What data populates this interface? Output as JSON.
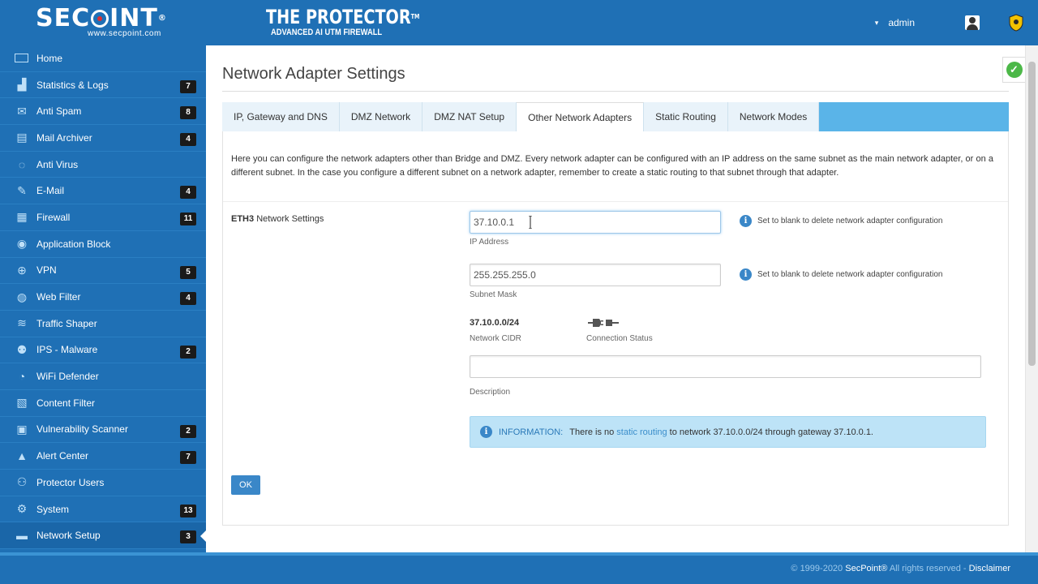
{
  "header": {
    "logo_text_1": "SEC",
    "logo_text_2": "INT",
    "logo_reg": "®",
    "logo_url": "www.secpoint.com",
    "product_title": "THE PROTECTOR",
    "product_tm": "TM",
    "product_subtitle": "ADVANCED AI UTM FIREWALL",
    "user_caret": "▾",
    "user_name": "admin"
  },
  "sidebar": {
    "items": [
      {
        "label": "Home",
        "badge": "",
        "icon": "home-icon"
      },
      {
        "label": "Statistics & Logs",
        "badge": "7",
        "icon": "chart-icon"
      },
      {
        "label": "Anti Spam",
        "badge": "8",
        "icon": "antispam-icon"
      },
      {
        "label": "Mail Archiver",
        "badge": "4",
        "icon": "archive-icon"
      },
      {
        "label": "Anti Virus",
        "badge": "",
        "icon": "antivirus-icon"
      },
      {
        "label": "E-Mail",
        "badge": "4",
        "icon": "email-icon"
      },
      {
        "label": "Firewall",
        "badge": "11",
        "icon": "firewall-icon"
      },
      {
        "label": "Application Block",
        "badge": "",
        "icon": "app-block-icon"
      },
      {
        "label": "VPN",
        "badge": "5",
        "icon": "vpn-icon"
      },
      {
        "label": "Web Filter",
        "badge": "4",
        "icon": "web-filter-icon"
      },
      {
        "label": "Traffic Shaper",
        "badge": "",
        "icon": "traffic-icon"
      },
      {
        "label": "IPS - Malware",
        "badge": "2",
        "icon": "ips-icon"
      },
      {
        "label": "WiFi Defender",
        "badge": "",
        "icon": "wifi-icon"
      },
      {
        "label": "Content Filter",
        "badge": "",
        "icon": "content-filter-icon"
      },
      {
        "label": "Vulnerability Scanner",
        "badge": "2",
        "icon": "scanner-icon"
      },
      {
        "label": "Alert Center",
        "badge": "7",
        "icon": "alert-icon"
      },
      {
        "label": "Protector Users",
        "badge": "",
        "icon": "users-icon"
      },
      {
        "label": "System",
        "badge": "13",
        "icon": "gear-icon"
      },
      {
        "label": "Network Setup",
        "badge": "3",
        "icon": "network-icon",
        "active": true
      }
    ]
  },
  "main": {
    "title": "Network Adapter Settings",
    "tabs": [
      {
        "label": "IP, Gateway and DNS"
      },
      {
        "label": "DMZ Network"
      },
      {
        "label": "DMZ NAT Setup"
      },
      {
        "label": "Other Network Adapters",
        "active": true
      },
      {
        "label": "Static Routing"
      },
      {
        "label": "Network Modes"
      }
    ],
    "intro": "Here you can configure the network adapters other than Bridge and DMZ. Every network adapter can be configured with an IP address on the same subnet as the main network adapter, or on a different subnet. In the case you configure a different subnet on a network adapter, remember to create a static routing to that subnet through that adapter.",
    "adapter_name": "ETH3",
    "adapter_label": "Network Settings",
    "ip_address": {
      "value": "37.10.0.1",
      "caption": "IP Address",
      "hint": "Set to blank to delete network adapter configuration"
    },
    "subnet_mask": {
      "value": "255.255.255.0",
      "caption": "Subnet Mask",
      "hint": "Set to blank to delete network adapter configuration"
    },
    "cidr": {
      "value": "37.10.0.0/24",
      "caption": "Network CIDR"
    },
    "connection": {
      "caption": "Connection Status"
    },
    "description": {
      "value": "",
      "caption": "Description"
    },
    "info": {
      "title": "INFORMATION:",
      "text_before": "There is no",
      "link": "static routing",
      "text_after": "to network 37.10.0.0/24 through gateway 37.10.0.1."
    },
    "ok_label": "OK"
  },
  "footer": {
    "copyright": "© 1999-2020",
    "brand": "SecPoint®",
    "rights": "All rights reserved -",
    "disclaimer": "Disclaimer"
  },
  "colors": {
    "brand_blue": "#1f70b5",
    "tab_bar": "#5ab4e8",
    "info_bg": "#bde3f7",
    "button": "#3a87c8",
    "status_ok": "#4cb848"
  }
}
